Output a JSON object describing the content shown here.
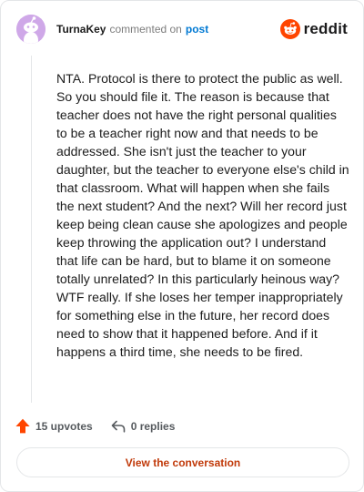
{
  "comment": {
    "username": "TurnaKey",
    "commented_on": "commented on",
    "post_link": "post",
    "body": "NTA. Protocol is there to protect the public as well. So you should file it. The reason is because that teacher does not have the right personal qualities to be a teacher right now and that needs to be addressed. She isn't just the teacher to your daughter, but the teacher to everyone else's child in that classroom. What will happen when she fails the next student? And the next? Will her record just keep being clean cause she apologizes and people keep throwing the application out? I understand that life can be hard, but to blame it on someone totally unrelated? In this particularly heinous way? WTF really. If she loses her temper inappropriately for something else in the future, her record does need to show that it happened before. And if it happens a third time, she needs to be fired."
  },
  "brand": {
    "word": "reddit",
    "color": "#ff4500"
  },
  "actions": {
    "upvotes": "15 upvotes",
    "replies": "0 replies"
  },
  "view_button": "View the conversation",
  "icons": {
    "avatar": "snoo-avatar-icon",
    "logo": "reddit-logo-icon",
    "upvote": "upvote-arrow-icon",
    "reply": "reply-arrow-icon"
  },
  "colors": {
    "upvote": "#ff4500",
    "link": "#0079d3",
    "button_text": "#c13a0a",
    "avatar_bg": "#cfa8e8"
  }
}
